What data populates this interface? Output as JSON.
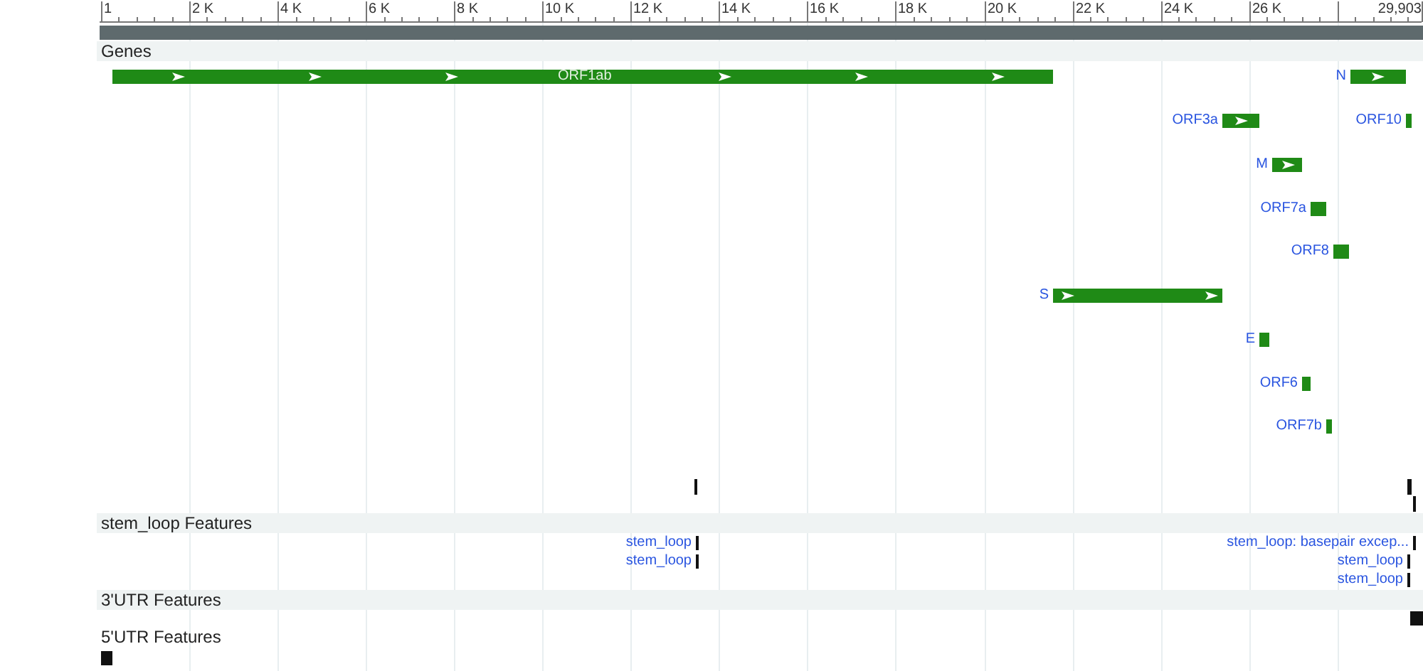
{
  "ruler": {
    "ticks": [
      "1",
      "2 K",
      "4 K",
      "6 K",
      "8 K",
      "10 K",
      "12 K",
      "14 K",
      "16 K",
      "18 K",
      "20 K",
      "22 K",
      "24 K",
      "26 K",
      "29,903"
    ]
  },
  "tracks": [
    {
      "title": "Genes",
      "features": [
        {
          "label": "ORF1ab"
        },
        {
          "label": "N"
        },
        {
          "label": "ORF3a"
        },
        {
          "label": "ORF10"
        },
        {
          "label": "M"
        },
        {
          "label": "ORF7a"
        },
        {
          "label": "ORF8"
        },
        {
          "label": "S"
        },
        {
          "label": "E"
        },
        {
          "label": "ORF6"
        },
        {
          "label": "ORF7b"
        }
      ]
    },
    {
      "title": "stem_loop Features",
      "features": [
        {
          "label": "stem_loop"
        },
        {
          "label": "stem_loop"
        },
        {
          "label": "stem_loop: basepair excep..."
        },
        {
          "label": "stem_loop"
        },
        {
          "label": "stem_loop"
        }
      ]
    },
    {
      "title": "3'UTR Features"
    },
    {
      "title": "5'UTR Features"
    }
  ]
}
